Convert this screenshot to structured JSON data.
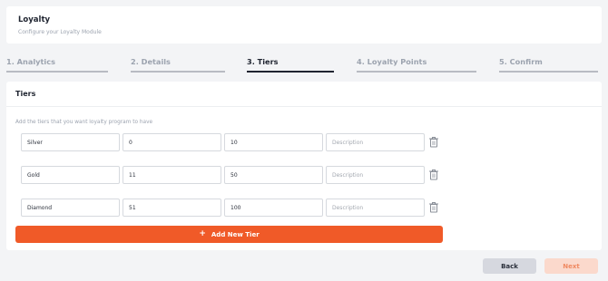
{
  "header": {
    "title": "Loyalty",
    "subtitle": "Configure your Loyalty Module"
  },
  "steps": [
    {
      "label": "1. Analytics",
      "active": false
    },
    {
      "label": "2. Details",
      "active": false
    },
    {
      "label": "3. Tiers",
      "active": true
    },
    {
      "label": "4. Loyalty Points",
      "active": false
    },
    {
      "label": "5. Confirm",
      "active": false
    }
  ],
  "tiers_section": {
    "title": "Tiers",
    "hint": "Add the tiers that you want loyalty program to have",
    "description_placeholder": "Description",
    "rows": [
      {
        "name": "Silver",
        "min": "0",
        "max": "10",
        "description": ""
      },
      {
        "name": "Gold",
        "min": "11",
        "max": "50",
        "description": ""
      },
      {
        "name": "Diamond",
        "min": "51",
        "max": "100",
        "description": ""
      }
    ],
    "add_label": "Add New Tier"
  },
  "footer": {
    "back_label": "Back",
    "next_label": "Next"
  },
  "colors": {
    "accent": "#f05a28",
    "next_disabled_bg": "#fbd9cc",
    "back_bg": "#d6d8df"
  }
}
